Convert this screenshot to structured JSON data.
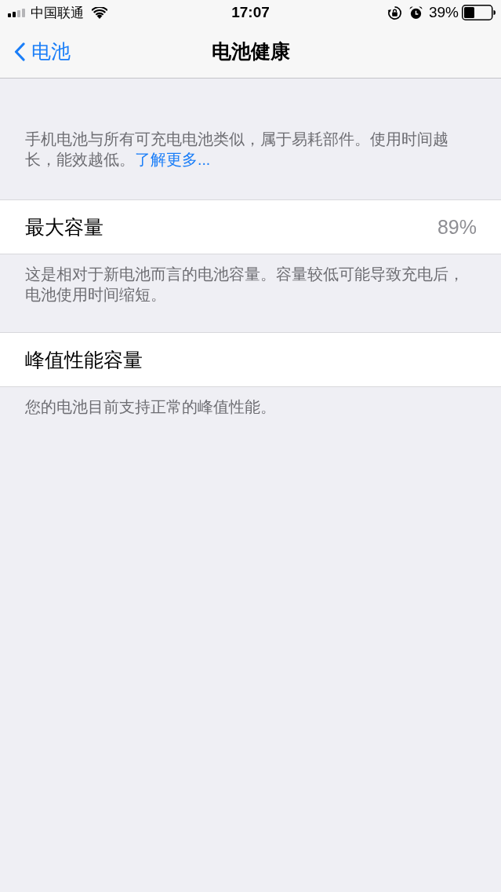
{
  "status_bar": {
    "carrier": "中国联通",
    "time": "17:07",
    "battery_percent": "39%"
  },
  "nav_bar": {
    "back_label": "电池",
    "title": "电池健康"
  },
  "intro": {
    "text": "手机电池与所有可充电电池类似，属于易耗部件。使用时间越长，能效越低。",
    "link": "了解更多..."
  },
  "sections": [
    {
      "label": "最大容量",
      "value": "89%",
      "footer": "这是相对于新电池而言的电池容量。容量较低可能导致充电后，电池使用时间缩短。"
    },
    {
      "label": "峰值性能容量",
      "footer": "您的电池目前支持正常的峰值性能。"
    }
  ]
}
